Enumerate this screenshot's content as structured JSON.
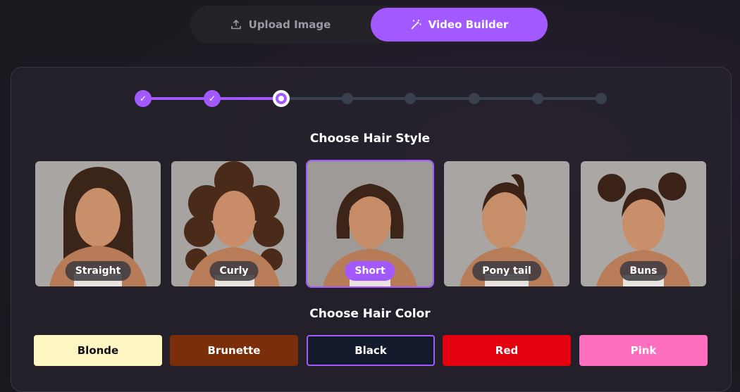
{
  "tabs": [
    {
      "label": "Upload Image",
      "icon": "upload-icon",
      "active": false
    },
    {
      "label": "Video Builder",
      "icon": "magic-wand-icon",
      "active": true
    }
  ],
  "stepper": {
    "total_steps": 8,
    "completed": 2,
    "current_step": 3
  },
  "hair_style": {
    "title": "Choose Hair Style",
    "options": [
      {
        "label": "Straight",
        "selected": false
      },
      {
        "label": "Curly",
        "selected": false
      },
      {
        "label": "Short",
        "selected": true
      },
      {
        "label": "Pony tail",
        "selected": false
      },
      {
        "label": "Buns",
        "selected": false
      }
    ]
  },
  "hair_color": {
    "title": "Choose Hair Color",
    "options": [
      {
        "label": "Blonde",
        "bg": "#fdf6c3",
        "fg": "#111111",
        "selected": false
      },
      {
        "label": "Brunette",
        "bg": "#7a2e0a",
        "fg": "#ffffff",
        "selected": false
      },
      {
        "label": "Black",
        "bg": "#131a2b",
        "fg": "#ffffff",
        "selected": true
      },
      {
        "label": "Red",
        "bg": "#e3000f",
        "fg": "#ffffff",
        "selected": false
      },
      {
        "label": "Pink",
        "bg": "#ff6fbf",
        "fg": "#ffffff",
        "selected": false
      }
    ]
  },
  "colors": {
    "accent": "#a259ff",
    "inactive_track": "#394150"
  }
}
